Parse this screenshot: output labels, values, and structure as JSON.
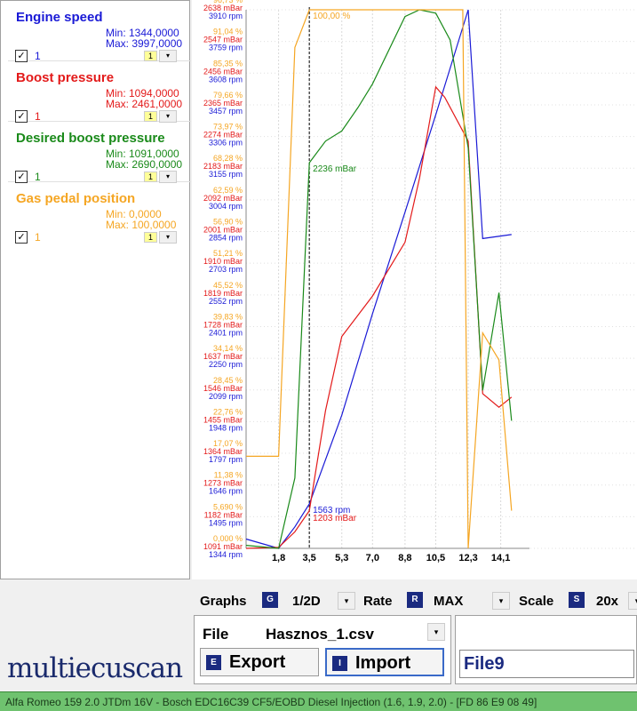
{
  "channels": [
    {
      "name": "Engine speed",
      "min": "Min: 1344,0000",
      "max": "Max: 3997,0000",
      "num": "1",
      "badge": "1",
      "color": "#1a1ad6"
    },
    {
      "name": "Boost pressure",
      "min": "Min: 1094,0000",
      "max": "Max: 2461,0000",
      "num": "1",
      "badge": "1",
      "color": "#e31a1a"
    },
    {
      "name": "Desired boost pressure",
      "min": "Min: 1091,0000",
      "max": "Max: 2690,0000",
      "num": "1",
      "badge": "1",
      "color": "#1a8a1a"
    },
    {
      "name": "Gas pedal position",
      "min": "Min: 0,0000",
      "max": "Max: 100,0000",
      "num": "1",
      "badge": "1",
      "color": "#f5a623"
    }
  ],
  "controls": {
    "graphs_label": "Graphs",
    "graphs_badge": "G",
    "graphs_value": "1/2D",
    "rate_label": "Rate",
    "rate_badge": "R",
    "rate_value": "MAX",
    "scale_label": "Scale",
    "scale_badge": "S",
    "scale_value": "20x"
  },
  "file": {
    "label": "File",
    "value": "Hasznos_1.csv",
    "export_label": "Export",
    "export_badge": "E",
    "import_label": "Import",
    "import_badge": "I",
    "file_number": "File9"
  },
  "logo": "multiecuscan",
  "status": "Alfa Romeo 159 2.0 JTDm 16V - Bosch EDC16C39 CF5/EOBD Diesel Injection (1.6, 1.9, 2.0) - [FD 86 E9 08 49]",
  "chart_data": {
    "type": "line",
    "x_ticks": [
      "1,8",
      "3,5",
      "5,3",
      "7,0",
      "8,8",
      "10,5",
      "12,3",
      "14,1"
    ],
    "x_tick_values": [
      1.8,
      3.5,
      5.3,
      7.0,
      8.8,
      10.5,
      12.3,
      14.1
    ],
    "xlim": [
      0,
      15.2
    ],
    "cursor_x": 3.5,
    "y_axis": {
      "pct": [
        "96,73 %",
        "91,04 %",
        "85,35 %",
        "79,66 %",
        "73,97 %",
        "68,28 %",
        "62,59 %",
        "56,90 %",
        "51,21 %",
        "45,52 %",
        "39,83 %",
        "34,14 %",
        "28,45 %",
        "22,76 %",
        "17,07 %",
        "11,38 %",
        "5,690 %",
        "0,000 %"
      ],
      "mbar": [
        "2638 mBar",
        "2547 mBar",
        "2456 mBar",
        "2365 mBar",
        "2274 mBar",
        "2183 mBar",
        "2092 mBar",
        "2001 mBar",
        "1910 mBar",
        "1819 mBar",
        "1728 mBar",
        "1637 mBar",
        "1546 mBar",
        "1455 mBar",
        "1364 mBar",
        "1273 mBar",
        "1182 mBar",
        "1091 mBar"
      ],
      "rpm": [
        "3910 rpm",
        "3759 rpm",
        "3608 rpm",
        "3457 rpm",
        "3306 rpm",
        "3155 rpm",
        "3004 rpm",
        "2854 rpm",
        "2703 rpm",
        "2552 rpm",
        "2401 rpm",
        "2250 rpm",
        "2099 rpm",
        "1948 rpm",
        "1797 rpm",
        "1646 rpm",
        "1495 rpm",
        "1344 rpm"
      ]
    },
    "annotations": [
      "100,00 %",
      "2236 mBar",
      "1563 rpm",
      "1203 mBar"
    ],
    "series": [
      {
        "name": "Engine speed",
        "color": "#1a1ad6",
        "x": [
          0,
          1.8,
          2.7,
          3.5,
          5.3,
          7.0,
          8.8,
          10.5,
          12.3,
          13.1,
          14.7
        ],
        "y": [
          1390,
          1344,
          1450,
          1563,
          2000,
          2500,
          3000,
          3480,
          3997,
          2870,
          2890
        ]
      },
      {
        "name": "Boost pressure",
        "color": "#e31a1a",
        "x": [
          0,
          1.8,
          2.7,
          3.5,
          4.4,
          5.3,
          7.0,
          8.8,
          9.6,
          10.5,
          11.0,
          12.3,
          13.1,
          14.0,
          14.7
        ],
        "y": [
          1091,
          1094,
          1140,
          1203,
          1500,
          1720,
          1840,
          2000,
          2190,
          2461,
          2430,
          2300,
          1550,
          1510,
          1540
        ]
      },
      {
        "name": "Desired boost pressure",
        "color": "#1a8a1a",
        "x": [
          0,
          1.8,
          2.7,
          3.5,
          4.4,
          5.3,
          6.2,
          7.0,
          8.8,
          9.6,
          10.5,
          11.3,
          12.3,
          13.1,
          14.0,
          14.7
        ],
        "y": [
          1100,
          1091,
          1300,
          2236,
          2300,
          2330,
          2400,
          2470,
          2670,
          2690,
          2680,
          2600,
          2280,
          1560,
          1850,
          1470
        ]
      },
      {
        "name": "Gas pedal position",
        "color": "#f5a623",
        "x": [
          0,
          1.8,
          2.7,
          3.5,
          12.0,
          12.3,
          13.1,
          14.0,
          14.7
        ],
        "y": [
          17.1,
          17.1,
          93,
          100,
          100,
          0,
          40,
          35,
          7
        ]
      }
    ]
  }
}
